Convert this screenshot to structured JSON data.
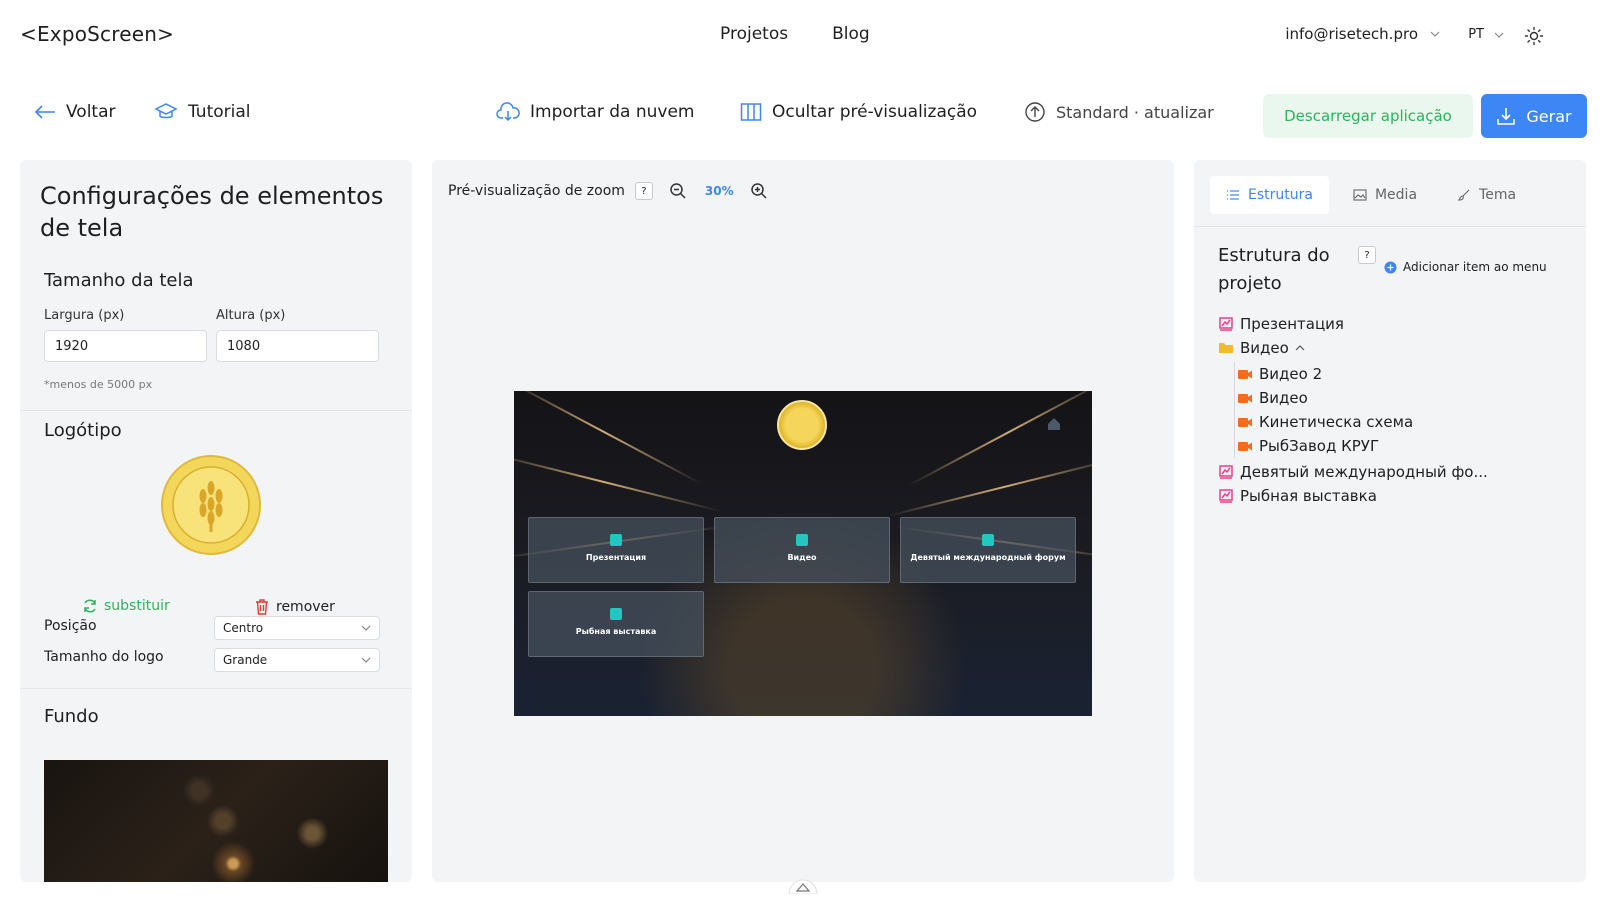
{
  "header": {
    "logo": "<ExpoScreen>",
    "nav": [
      "Projetos",
      "Blog"
    ],
    "account": "info@risetech.pro",
    "language": "PT"
  },
  "toolbar": {
    "back": "Voltar",
    "tutorial": "Tutorial",
    "import_cloud": "Importar da nuvem",
    "hide_preview": "Ocultar pré-visualização",
    "plan": "Standard · atualizar",
    "download": "Descarregar aplicação",
    "generate": "Gerar"
  },
  "left_panel": {
    "title": "Configurações de elementos de tela",
    "screen_size": {
      "title": "Tamanho da tela",
      "width_label": "Largura (px)",
      "width_value": "1920",
      "height_label": "Altura (px)",
      "height_value": "1080",
      "hint": "*menos de 5000 px"
    },
    "logo": {
      "title": "Logótipo",
      "replace": "substituir",
      "remove": "remover",
      "position_label": "Posição",
      "position_value": "Centro",
      "size_label": "Tamanho do logo",
      "size_value": "Grande"
    },
    "background": {
      "title": "Fundo"
    }
  },
  "center_panel": {
    "zoom_label": "Pré-visualização de zoom",
    "help": "?",
    "zoom_value": "30%",
    "preview_cards": [
      "Презентация",
      "Видео",
      "Девятый международный форум",
      "Рыбная выставка"
    ]
  },
  "right_panel": {
    "tabs": [
      "Estrutura",
      "Media",
      "Tema"
    ],
    "structure_title": "Estrutura do projeto",
    "help": "?",
    "add_menu_item": "Adicionar item ao menu",
    "tree": [
      {
        "label": "Презентация",
        "icon": "presentation-icon"
      },
      {
        "label": "Видео",
        "icon": "folder-icon",
        "children": [
          "Видео 2",
          "Видео",
          "Кинетическа схема",
          "РыбЗавод КРУГ"
        ]
      },
      {
        "label": "Девятый международный фо...",
        "icon": "presentation-icon"
      },
      {
        "label": "Рыбная выставка",
        "icon": "presentation-icon"
      }
    ]
  },
  "colors": {
    "accent": "#3d86f5",
    "success": "#2cb35b",
    "panel_bg": "#f3f4f6",
    "video_icon": "#f26b21",
    "folder_icon": "#f5b82e",
    "presentation_icon": "#e6428b"
  }
}
